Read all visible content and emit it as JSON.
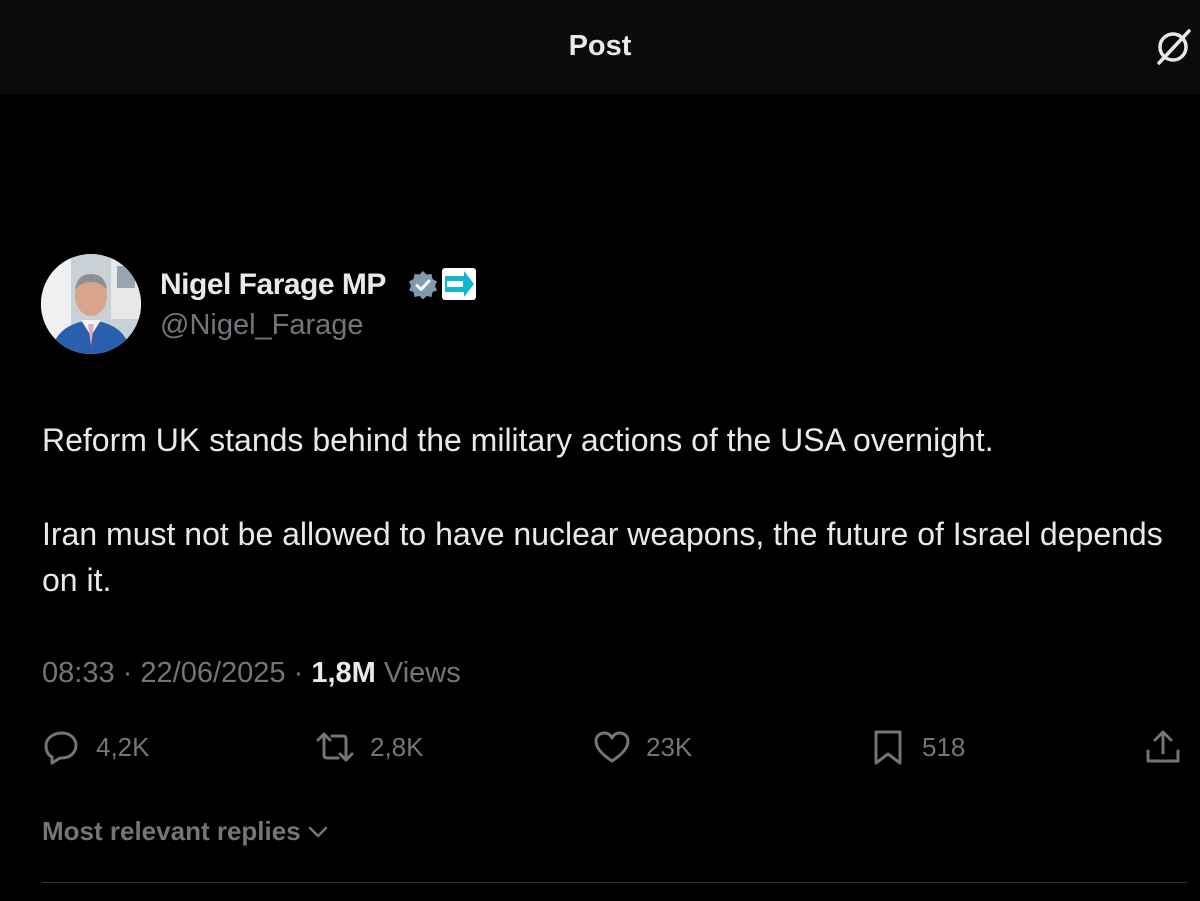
{
  "header": {
    "title": "Post",
    "icon": "grok-slash-icon"
  },
  "author": {
    "name": "Nigel Farage MP",
    "handle": "@Nigel_Farage",
    "verified_icon": "verified-badge-icon",
    "affiliation_badge": {
      "icon": "reform-uk-logo",
      "text": "REFORM UK",
      "color": "#12b6cf"
    }
  },
  "post": {
    "paragraphs": [
      "Reform UK stands behind the military actions of the USA overnight.",
      "Iran must not be allowed to have nuclear weapons, the future of Israel depends on it."
    ],
    "time": "08:33",
    "date": "22/06/2025",
    "separator": "·",
    "views_count": "1,8M",
    "views_label": "Views"
  },
  "actions": {
    "replies": {
      "icon": "reply-icon",
      "count": "4,2K"
    },
    "reposts": {
      "icon": "repost-icon",
      "count": "2,8K"
    },
    "likes": {
      "icon": "heart-icon",
      "count": "23K"
    },
    "bookmarks": {
      "icon": "bookmark-icon",
      "count": "518"
    },
    "share": {
      "icon": "share-icon"
    }
  },
  "replies_sort": {
    "label": "Most relevant replies",
    "icon": "chevron-down-icon"
  },
  "colors": {
    "background": "#000000",
    "text": "#e7e9ea",
    "muted": "#71767b",
    "verified": "#829aab"
  }
}
